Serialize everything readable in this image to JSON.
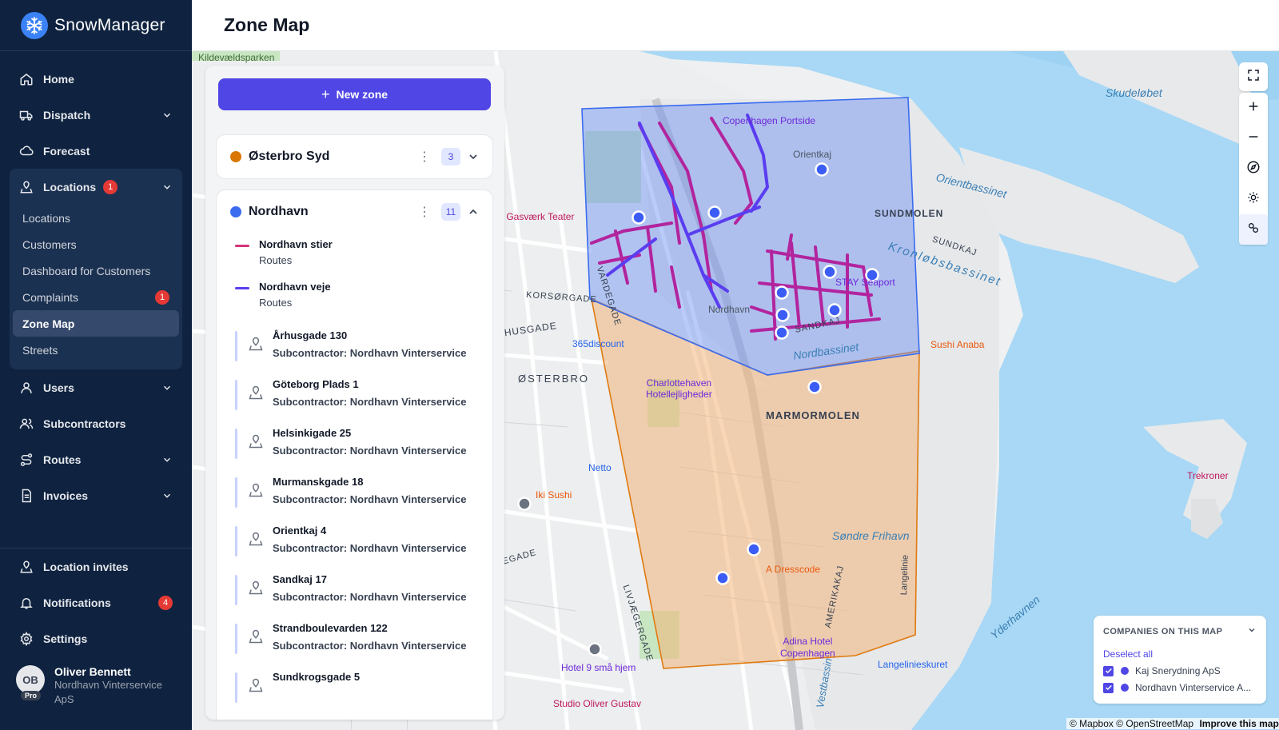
{
  "app": {
    "name": "SnowManager"
  },
  "page": {
    "title": "Zone Map"
  },
  "sidebar": {
    "nav": [
      {
        "label": "Home",
        "icon": "home-icon"
      },
      {
        "label": "Dispatch",
        "icon": "truck-icon"
      },
      {
        "label": "Forecast",
        "icon": "cloud-icon"
      }
    ],
    "locations": {
      "label": "Locations",
      "badge": "1",
      "sub": [
        {
          "label": "Locations"
        },
        {
          "label": "Customers"
        },
        {
          "label": "Dashboard for Customers"
        },
        {
          "label": "Complaints",
          "badge": "1"
        },
        {
          "label": "Zone Map"
        },
        {
          "label": "Streets"
        }
      ]
    },
    "nav2": [
      {
        "label": "Users"
      },
      {
        "label": "Subcontractors"
      },
      {
        "label": "Routes"
      },
      {
        "label": "Invoices"
      }
    ],
    "bottom": [
      {
        "label": "Location invites"
      },
      {
        "label": "Notifications",
        "badge": "4"
      },
      {
        "label": "Settings"
      }
    ],
    "user": {
      "initials": "OB",
      "plan": "Pro",
      "name": "Oliver Bennett",
      "company": "Nordhavn Vinterservice ApS"
    }
  },
  "panel": {
    "new_zone_label": "New zone",
    "zones": [
      {
        "name": "Østerbro Syd",
        "count": "3",
        "color": "#d97706"
      },
      {
        "name": "Nordhavn",
        "count": "11",
        "color": "#3b6cf0"
      }
    ],
    "routes": [
      {
        "name": "Nordhavn stier",
        "type": "Routes",
        "color": "#c026d3"
      },
      {
        "name": "Nordhavn veje",
        "type": "Routes",
        "color": "#4f46e5"
      }
    ],
    "locations": [
      {
        "name": "Århusgade 130",
        "sub": "Subcontractor: Nordhavn Vinterservice ApS"
      },
      {
        "name": "Göteborg Plads 1",
        "sub": "Subcontractor: Nordhavn Vinterservice ApS"
      },
      {
        "name": "Helsinkigade 25",
        "sub": "Subcontractor: Nordhavn Vinterservice ApS"
      },
      {
        "name": "Murmanskgade 18",
        "sub": "Subcontractor: Nordhavn Vinterservice ApS"
      },
      {
        "name": "Orientkaj 4",
        "sub": "Subcontractor: Nordhavn Vinterservice ApS"
      },
      {
        "name": "Sandkaj 17",
        "sub": "Subcontractor: Nordhavn Vinterservice ApS"
      },
      {
        "name": "Strandboulevarden 122",
        "sub": "Subcontractor: Nordhavn Vinterservice ApS"
      },
      {
        "name": "Sundkrogsgade 5",
        "sub": ""
      }
    ]
  },
  "map": {
    "labels": {
      "kildevaeldsparken": "Kildevældsparken",
      "skudelobet": "Skudeløbet",
      "orientbassinet": "Orientbassinet",
      "kronlobsbassinet": "Kronløbsbassinet",
      "sundmolen": "SUNDMOLEN",
      "sundkaj": "SUNDKAJ",
      "vardegade": "VARDEGADE",
      "korsorgade": "KORSØRGADE",
      "arhusgade": "ÅRHUSGADE",
      "osterbro": "ØSTERBRO",
      "nordbassinet": "Nordbassinet",
      "sandkaj": "SANDKAJ",
      "marmormolen": "MARMORMOLEN",
      "sondre_frihavn": "Søndre Frihavn",
      "amerikakaj": "AMERIKAKAJ",
      "langelinie": "Langelinie",
      "livjaegergade": "LIVJÆGERGADE",
      "vestbassin": "Vestbassin",
      "yderhavnen": "Yderhavnen",
      "rosenvaengets": "SEGADE"
    },
    "pois": {
      "copenhagen_portside": "Copenhagen Portside",
      "orientkaj": "Orientkaj",
      "stay_seaport": "STAY Seaport",
      "nordhavn": "Nordhavn",
      "gasvaerk": "stre Gasværk Teater",
      "discount365": "365discount",
      "charlottehaven": "Charlottehaven\nHotellejligheder",
      "sushi_anaba": "Sushi Anaba",
      "netto": "Netto",
      "iki_sushi": "Iki Sushi",
      "a_dresscode": "A Dresscode",
      "adina": "Adina Hotel\nCopenhagen",
      "langelinieskuret": "Langelinieskuret",
      "hotel9": "Hotel 9 små hjem",
      "studio": "Studio Oliver Gustav",
      "trekroner": "Trekroner",
      "mapbox": "mapbox"
    }
  },
  "companies": {
    "title": "COMPANIES ON THIS MAP",
    "deselect_label": "Deselect all",
    "items": [
      {
        "name": "Kaj Snerydning ApS"
      },
      {
        "name": "Nordhavn Vinterservice A..."
      }
    ]
  },
  "attribution": {
    "mapbox": "© Mapbox",
    "osm": "© OpenStreetMap",
    "improve": "Improve this map"
  }
}
